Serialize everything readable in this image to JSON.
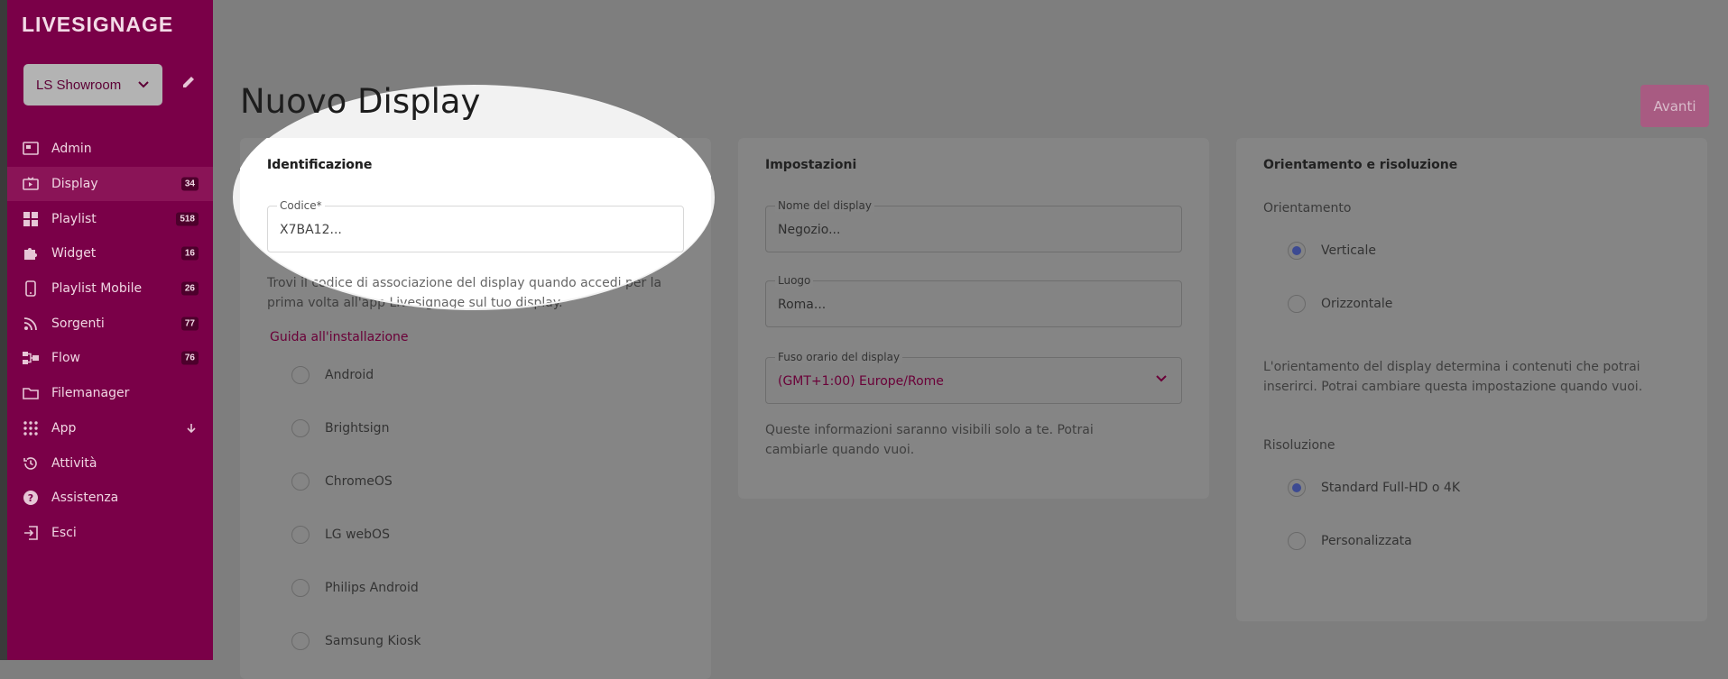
{
  "sidebar": {
    "logo": "LIVESIGNAGE",
    "store": "LS Showroom",
    "items": [
      {
        "label": "Admin",
        "badge": null
      },
      {
        "label": "Display",
        "badge": "34"
      },
      {
        "label": "Playlist",
        "badge": "518"
      },
      {
        "label": "Widget",
        "badge": "16"
      },
      {
        "label": "Playlist Mobile",
        "badge": "26"
      },
      {
        "label": "Sorgenti",
        "badge": "77"
      },
      {
        "label": "Flow",
        "badge": "76"
      },
      {
        "label": "Filemanager",
        "badge": null
      },
      {
        "label": "App",
        "badge": null
      },
      {
        "label": "Attività",
        "badge": null
      },
      {
        "label": "Assistenza",
        "badge": null
      },
      {
        "label": "Esci",
        "badge": null
      }
    ]
  },
  "header": {
    "title": "Nuovo Display",
    "next_label": "Avanti"
  },
  "identificazione": {
    "title": "Identificazione",
    "code_label": "Codice*",
    "code_value": "X7BA12...",
    "help": "Trovi il codice di associazione del display quando accedi per la prima volta all'app Livesignage sul tuo display.",
    "guide_link": "Guida all'installazione",
    "platforms": [
      "Android",
      "Brightsign",
      "ChromeOS",
      "LG webOS",
      "Philips Android",
      "Samsung Kiosk"
    ]
  },
  "impostazioni": {
    "title": "Impostazioni",
    "name_label": "Nome del display",
    "name_value": "Negozio...",
    "place_label": "Luogo",
    "place_value": "Roma...",
    "tz_label": "Fuso orario del display",
    "tz_value": "(GMT+1:00) Europe/Rome",
    "help": "Queste informazioni saranno visibili solo a te. Potrai cambiarle quando vuoi."
  },
  "orientamento": {
    "title": "Orientamento e risoluzione",
    "orientation_label": "Orientamento",
    "orientation_options": [
      "Verticale",
      "Orizzontale"
    ],
    "help": "L'orientamento del display determina i contenuti che potrai inserirci. Potrai cambiare questa impostazione quando vuoi.",
    "resolution_label": "Risoluzione",
    "resolution_options": [
      "Standard Full-HD o 4K",
      "Personalizzata"
    ]
  }
}
